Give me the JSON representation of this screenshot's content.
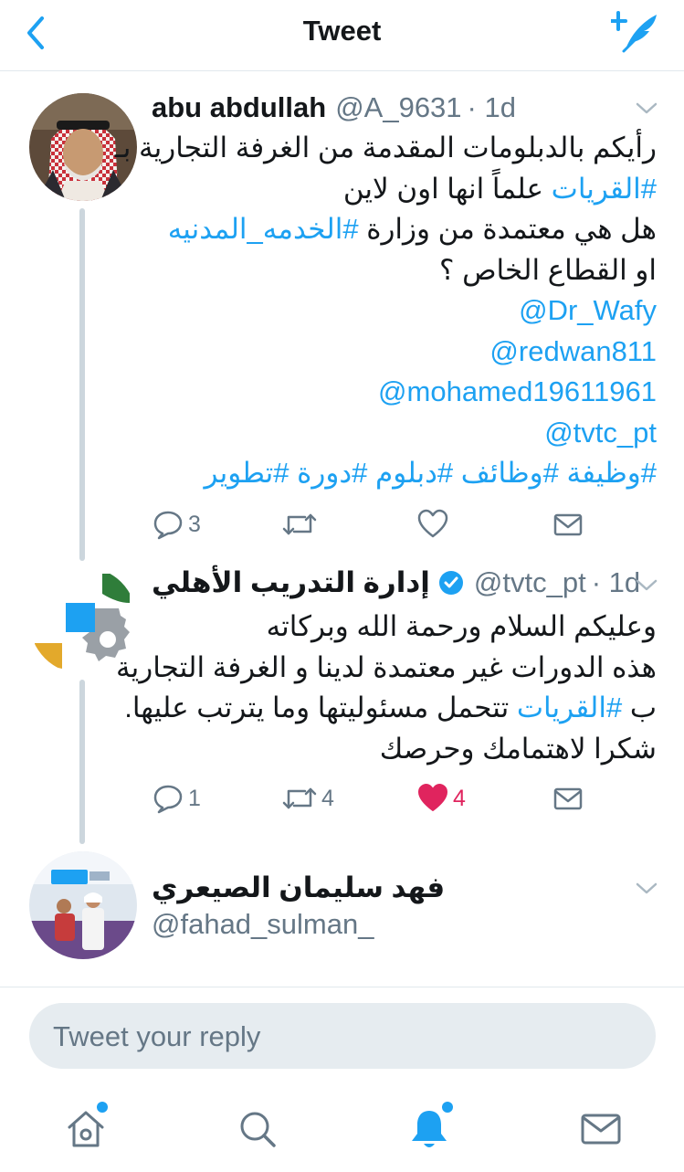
{
  "header": {
    "title": "Tweet"
  },
  "tweets": [
    {
      "name": "abu abdullah",
      "handle": "@A_9631",
      "time": "· 1d",
      "lines": [
        "رأيكم بالدبلومات المقدمة من الغرفة التجارية بـ",
        "علماً انها اون لاين",
        "#القريات",
        "هل هي معتمدة من وزارة",
        "#الخدمه_المدنيه",
        "او القطاع الخاص ؟"
      ],
      "mentions": [
        "@Dr_Wafy",
        "@redwan811",
        "@mohamed19611961",
        "@tvtc_pt"
      ],
      "hashtags": [
        "#وظيفة",
        "#وظائف",
        "#دبلوم",
        "#دورة",
        "#تطوير"
      ],
      "replies": "3",
      "retweets": "",
      "likes": ""
    },
    {
      "name": "إدارة التدريب الأهلي",
      "handle": "@tvtc_pt",
      "time": "· 1d",
      "lines": [
        "وعليكم السلام ورحمة الله وبركاته",
        "هذه الدورات غير معتمدة  لدينا و الغرفة التجارية",
        "ب",
        "#القريات",
        "تتحمل مسئوليتها وما يترتب عليها.",
        "شكرا لاهتمامك وحرصك"
      ],
      "replies": "1",
      "retweets": "4",
      "likes": "4"
    },
    {
      "name": "فهد سليمان الصيعري",
      "handle": "@fahad_sulman_"
    }
  ],
  "reply": {
    "placeholder": "Tweet your reply"
  },
  "colors": {
    "accent": "#1da1f2",
    "like": "#e0245e",
    "muted": "#657786"
  },
  "icons": {
    "back": "chevron-left-icon",
    "compose": "compose-feather-icon",
    "more": "chevron-down-icon",
    "verified": "verified-badge-icon",
    "reply": "reply-bubble-icon",
    "retweet": "retweet-icon",
    "like": "heart-icon",
    "share": "mail-icon",
    "home": "home-icon",
    "search": "search-icon",
    "notifications": "bell-icon",
    "messages": "mail-icon"
  }
}
